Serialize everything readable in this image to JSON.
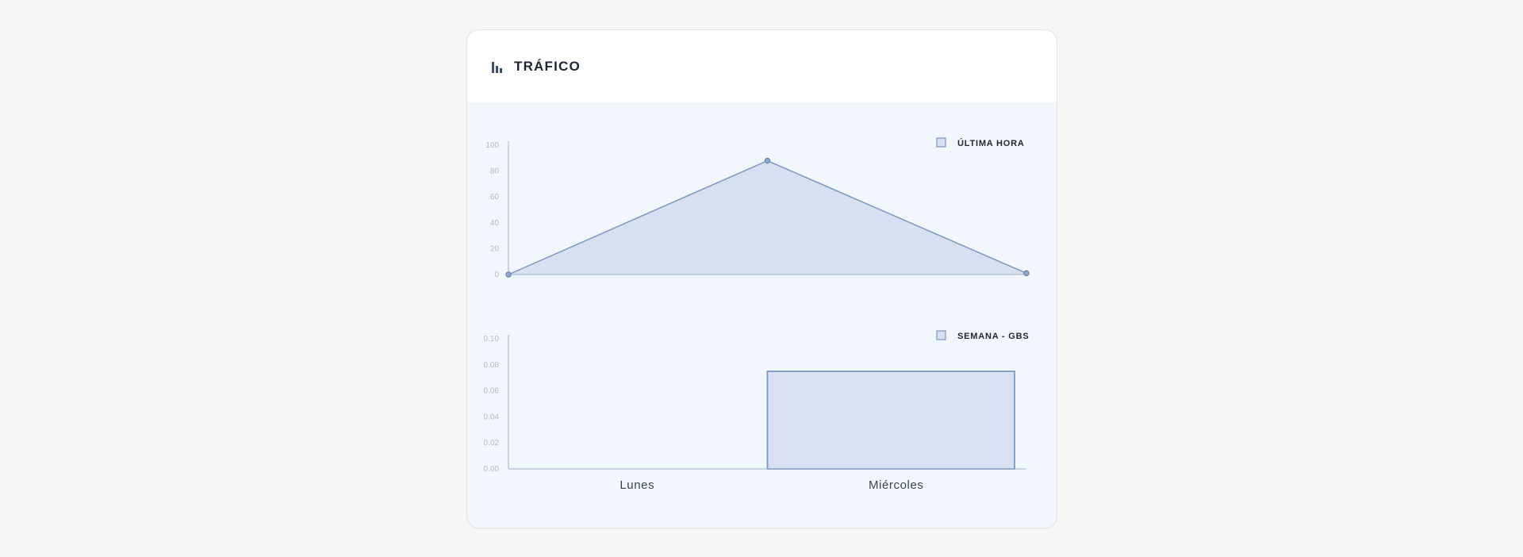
{
  "card": {
    "title": "TRÁFICO",
    "icon": "bar-chart-icon"
  },
  "colors": {
    "line": "#7b97c0",
    "area_fill": "#d6e0f0",
    "bar_fill": "#d9e0f2",
    "axis": "#9fb0c8",
    "legend_box_fill": "#d6e0f0"
  },
  "chart_data": [
    {
      "type": "area",
      "legend": "ÚLTIMA HORA",
      "x": [
        0,
        1,
        2
      ],
      "series": [
        {
          "name": "ÚLTIMA HORA",
          "values": [
            0,
            88,
            1
          ]
        }
      ],
      "ylim": [
        0,
        100
      ],
      "yticks": [
        "0",
        "20",
        "40",
        "60",
        "80",
        "100"
      ],
      "grid": false,
      "legend_position": "top-right"
    },
    {
      "type": "bar",
      "legend": "SEMANA - GBS",
      "categories": [
        "Lunes",
        "Miércoles"
      ],
      "series": [
        {
          "name": "SEMANA - GBS",
          "values": [
            0.0,
            0.075
          ]
        }
      ],
      "ylim": [
        0,
        0.1
      ],
      "yticks": [
        "0.00",
        "0.02",
        "0.04",
        "0.06",
        "0.08",
        "0.10"
      ],
      "grid": false,
      "legend_position": "top-right"
    }
  ]
}
